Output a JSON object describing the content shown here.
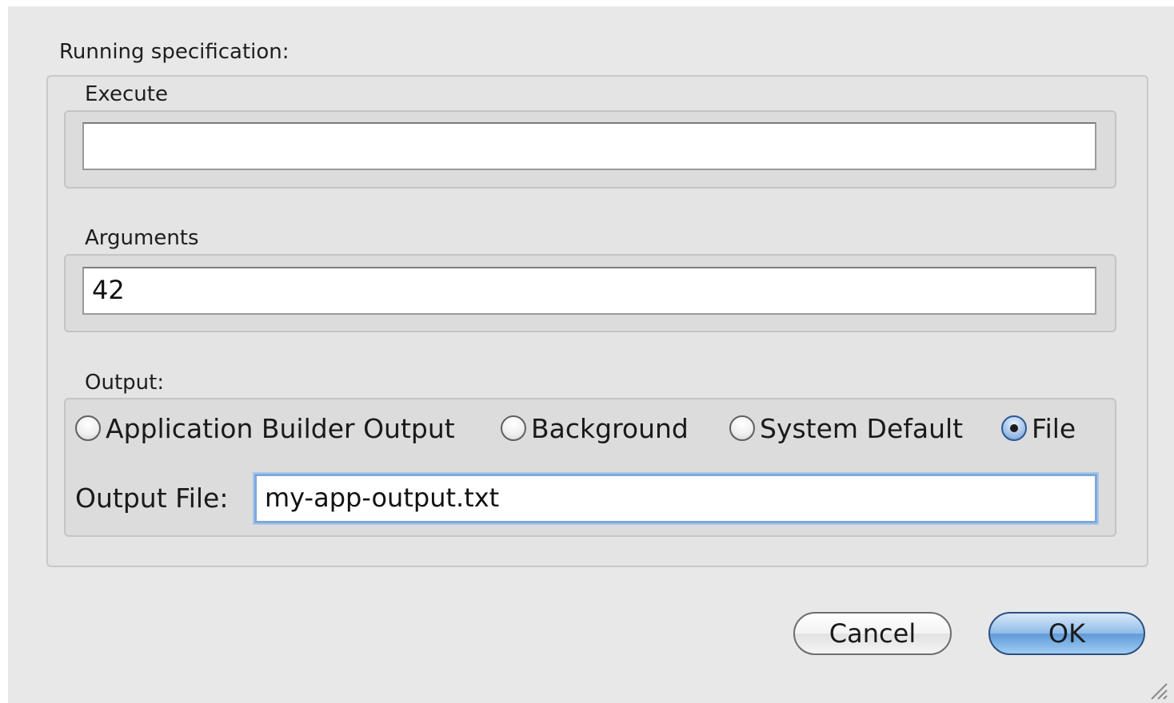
{
  "running_spec": {
    "title": "Running specification:",
    "execute": {
      "label": "Execute",
      "value": ""
    },
    "arguments": {
      "label": "Arguments",
      "value": "42"
    },
    "output": {
      "label": "Output:",
      "options": [
        {
          "label": "Application Builder Output",
          "selected": false
        },
        {
          "label": "Background",
          "selected": false
        },
        {
          "label": "System Default",
          "selected": false
        },
        {
          "label": "File",
          "selected": true
        }
      ],
      "file_label": "Output File:",
      "file_value": "my-app-output.txt"
    }
  },
  "buttons": {
    "cancel": "Cancel",
    "ok": "OK"
  },
  "colors": {
    "dialog_bg": "#e8e8e8",
    "focus_ring": "#7ea8dc",
    "default_button": "#6fa3dd"
  },
  "icons": {
    "resize_grip": "resize-grip-icon"
  }
}
